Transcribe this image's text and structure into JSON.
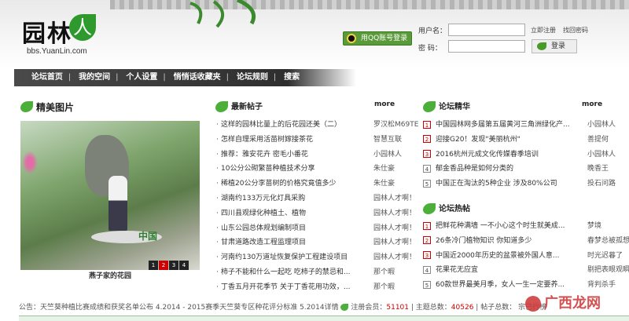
{
  "site": {
    "logo_text": "园林",
    "logo_mark": "人",
    "logo_url": "bbs.YuanLin.com"
  },
  "login": {
    "qq_button": "用QQ账号登录",
    "username_label": "用户名：",
    "password_label": "密  码：",
    "register_link": "立即注册",
    "forgot_link": "找回密码",
    "login_button": "登录"
  },
  "nav": {
    "items": [
      "论坛首页",
      "我的空间",
      "个人设置",
      "悄悄话收藏夹",
      "论坛规则",
      "搜索"
    ]
  },
  "featured": {
    "title": "精美图片",
    "caption": "燕子家的花园",
    "pages": [
      "1",
      "2",
      "3",
      "4"
    ],
    "photo_watermark": "中国"
  },
  "latest": {
    "title": "最新帖子",
    "more": "more",
    "posts": [
      {
        "title": "这样的园林比量上的后花园还美（二）",
        "author": "罗汉松M69TE"
      },
      {
        "title": "怎样自理采用活苗树嫁接茶花",
        "author": "智慧互联"
      },
      {
        "title": "推荐：雅安花卉  密毛小番花",
        "author": "小园林人"
      },
      {
        "title": "10公分公砌繁苗种植技术分享",
        "author": "朱仕豪"
      },
      {
        "title": "稀植20公分李苗树的价格究竟值多少",
        "author": "朱仕豪"
      },
      {
        "title": "湖南约133万元化灯具采购",
        "author": "园林人才啊！"
      },
      {
        "title": "四川县观绿化种植土、植物",
        "author": "园林人才啊！"
      },
      {
        "title": "山东公园总体规划编制项目",
        "author": "园林人才啊！"
      },
      {
        "title": "甘肃道路改造工程监理项目",
        "author": "园林人才啊！"
      },
      {
        "title": "河南约130万道址恢复保护工程建设项目",
        "author": "园林人才啊！"
      },
      {
        "title": "柿子不能和什么一起吃  吃柿子的禁忌和...",
        "author": "那个暇"
      },
      {
        "title": "丁香五月开花季节  关于丁香花用功效，...",
        "author": "那个暇"
      }
    ]
  },
  "essence": {
    "title": "论坛精华",
    "more": "more",
    "posts": [
      {
        "num": "1",
        "title": "中国园林网多届第五届黄河三角洲绿化产...",
        "author": "小园林人"
      },
      {
        "num": "2",
        "title": "迎接G20！发现\"美丽杭州\"",
        "author": "善提何"
      },
      {
        "num": "3",
        "title": "2016杭州元成文化传媒春季培训",
        "author": "小园林人"
      },
      {
        "num": "4",
        "title": "郁金香品种是如何分类的",
        "author": "晚香王"
      },
      {
        "num": "5",
        "title": "中国正在淘汰的5种企业  涉及80%公司",
        "author": "投石问路"
      }
    ]
  },
  "hot": {
    "title": "论坛热帖",
    "posts": [
      {
        "num": "1",
        "title": "把鲜花种满墙   一不小心这个时生就美成...",
        "author": "梦境"
      },
      {
        "num": "2",
        "title": "26条冷门植物知识   你知道多少",
        "author": "春梦总被孤想醒"
      },
      {
        "num": "3",
        "title": "中国近2000年历史的盆景被外国人意...",
        "author": "时光迟暮了"
      },
      {
        "num": "4",
        "title": "花果花无应宜",
        "author": "剔把表眼观瞬夜受"
      },
      {
        "num": "5",
        "title": "60款世界最美月季，女人一生一定要养...",
        "author": "背判杀手"
      }
    ]
  },
  "notice": {
    "prefix": "公告：",
    "text": "天竺葵种植比赛成绩和获奖名单公布  4.2014 - 2015赛季天竺葵专区种花评分标准  5.2014详情",
    "members_label": "注册会员：",
    "members": "51101",
    "topics_label": "主题总数：",
    "topics": "40526",
    "posts_label": "帖子总数：",
    "posts": "",
    "tail": "宗已行榜"
  },
  "watermark": {
    "text": "广西龙网"
  },
  "colors": {
    "brand_green": "#4caf3a",
    "nav_dark": "#333333",
    "accent_red": "#cc0000"
  }
}
